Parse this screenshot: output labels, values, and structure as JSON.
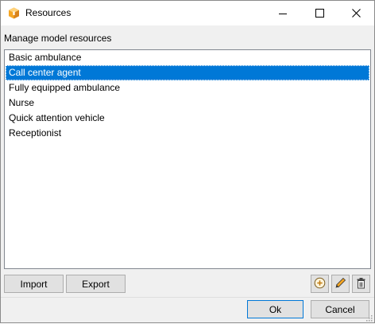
{
  "window": {
    "title": "Resources"
  },
  "heading": "Manage model resources",
  "resources": [
    {
      "label": "Basic ambulance",
      "selected": false
    },
    {
      "label": "Call center agent",
      "selected": true
    },
    {
      "label": "Fully equipped ambulance",
      "selected": false
    },
    {
      "label": "Nurse",
      "selected": false
    },
    {
      "label": "Quick attention vehicle",
      "selected": false
    },
    {
      "label": "Receptionist",
      "selected": false
    }
  ],
  "buttons": {
    "import_label": "Import",
    "export_label": "Export",
    "ok_label": "Ok",
    "cancel_label": "Cancel"
  },
  "icons": {
    "app": "cube-icon",
    "minimize": "minimize-icon",
    "maximize": "maximize-icon",
    "close": "close-icon",
    "add": "add-icon",
    "edit": "pencil-icon",
    "delete": "trash-icon"
  },
  "colors": {
    "selection": "#0078d7",
    "accent_orange": "#f5a623"
  }
}
